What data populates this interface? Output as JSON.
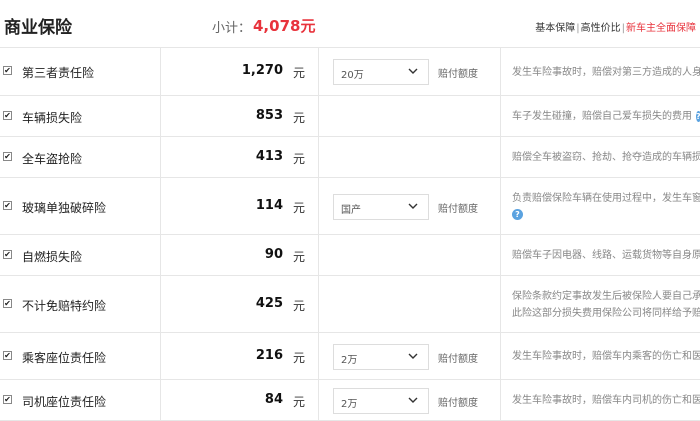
{
  "header": {
    "title": "商业保险",
    "subtotal_label": "小计：",
    "subtotal_value": "4,078元",
    "tabs": [
      "基本保障",
      "高性价比",
      "新车主全面保障"
    ],
    "separator": "|"
  },
  "unit": "元",
  "rows": [
    {
      "name": "第三者责任险",
      "checked": true,
      "price": "1,270",
      "select": "20万",
      "select_label": "赔付额度",
      "desc": [
        "发生车险事故时，赔偿对第三方造成的人身及"
      ],
      "help": false
    },
    {
      "name": "车辆损失险",
      "checked": true,
      "price": "853",
      "select": "",
      "select_label": "",
      "desc": [
        "车子发生碰撞，赔偿自己爱车损失的费用"
      ],
      "help": true
    },
    {
      "name": "全车盗抢险",
      "checked": true,
      "price": "413",
      "select": "",
      "select_label": "",
      "desc": [
        "赔偿全车被盗窃、抢劫、抢夺造成的车辆损失"
      ],
      "help": false
    },
    {
      "name": "玻璃单独破碎险",
      "checked": true,
      "price": "114",
      "select": "国产",
      "select_label": "赔付额度",
      "desc": [
        "负责赔偿保险车辆在使用过程中，发生车窗、"
      ],
      "help": true
    },
    {
      "name": "自燃损失险",
      "checked": true,
      "price": "90",
      "select": "",
      "select_label": "",
      "desc": [
        "赔偿车子因电器、线路、运载货物等自身原因"
      ],
      "help": false
    },
    {
      "name": "不计免赔特约险",
      "checked": true,
      "price": "425",
      "select": "",
      "select_label": "",
      "desc": [
        "保险条款约定事故发生后被保险人要自己承担",
        "此险这部分损失费用保险公司将同样给予赔偿"
      ],
      "help": false
    },
    {
      "name": "乘客座位责任险",
      "checked": true,
      "price": "216",
      "select": "2万",
      "select_label": "赔付额度",
      "desc": [
        "发生车险事故时，赔偿车内乘客的伤亡和医疗"
      ],
      "help": false
    },
    {
      "name": "司机座位责任险",
      "checked": true,
      "price": "84",
      "select": "2万",
      "select_label": "赔付额度",
      "desc": [
        "发生车险事故时，赔偿车内司机的伤亡和医疗"
      ],
      "help": false
    }
  ],
  "icons": {
    "checkbox": "checkmark-icon",
    "dropdown": "chevron-down-icon",
    "help": "help-icon"
  },
  "colors": {
    "accent": "#e8333c",
    "help": "#5aa2e0",
    "border": "#e6e6e6"
  }
}
